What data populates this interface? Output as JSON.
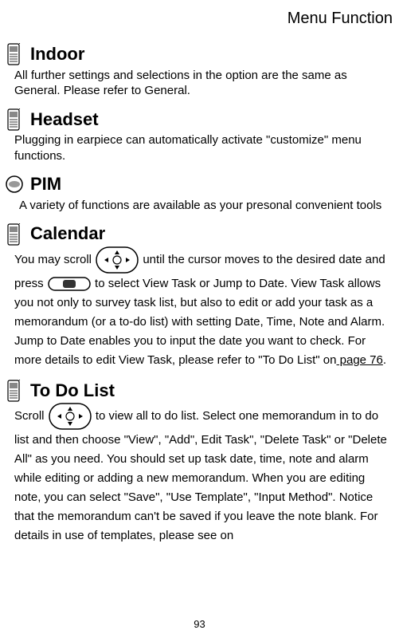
{
  "header": "Menu Function",
  "sections": {
    "indoor": {
      "title": "Indoor",
      "body": "All further settings and selections in the option are the same as General. Please refer to General."
    },
    "headset": {
      "title": "Headset",
      "body": "Plugging in earpiece can automatically activate \"customize\" menu functions."
    },
    "pim": {
      "title": "PIM",
      "body": "A variety of functions are available as your presonal convenient tools"
    },
    "calendar": {
      "title": "Calendar",
      "body_parts": {
        "p1": "You may scroll ",
        "p2": " until the cursor moves to the desired date and press ",
        "p3": " to select View Task or Jump to Date. View Task allows you not only to survey task list, but also to edit or add your task as a memorandum (or a to-do list) with setting Date, Time, Note and Alarm. Jump to Date enables you to input the date you want to check. For more details to edit View Task, please refer to \"To Do List\" on",
        "link": " page 76",
        "p4": "."
      }
    },
    "todolist": {
      "title": "To Do List",
      "body_parts": {
        "p1": "Scroll ",
        "p2": " to view all to do list. Select one memorandum in to do list and then choose \"View\", \"Add\", Edit Task\", \"Delete Task\" or \"Delete All\" as you need. You should set up task date, time, note and alarm while editing or adding a new memorandum. When you are editing note, you can select \"Save\", \"Use Template\", \"Input Method\". Notice that the memorandum can't be saved if you leave the note blank. For details in use of templates, please see on"
      }
    }
  },
  "page_number": "93"
}
